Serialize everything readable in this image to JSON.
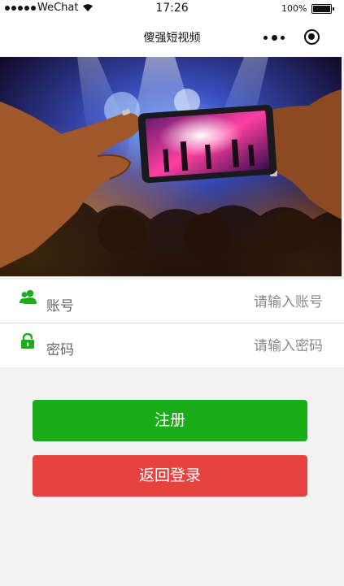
{
  "status_bar": {
    "carrier": "WeChat",
    "time": "17:26",
    "battery_percent": "100%"
  },
  "nav": {
    "title": "傻强短视频"
  },
  "banner": {
    "image": "concert-phone-photo"
  },
  "form": {
    "account": {
      "label": "账号",
      "placeholder": "请输入账号",
      "value": "",
      "icon": "user-icon"
    },
    "password": {
      "label": "密码",
      "placeholder": "请输入密码",
      "value": "",
      "icon": "lock-icon"
    }
  },
  "actions": {
    "register_label": "注册",
    "back_login_label": "返回登录"
  },
  "colors": {
    "primary_green": "#1aad19",
    "warn_red": "#e64340",
    "icon_green": "#1aad19",
    "page_bg": "#f2f2f2"
  }
}
